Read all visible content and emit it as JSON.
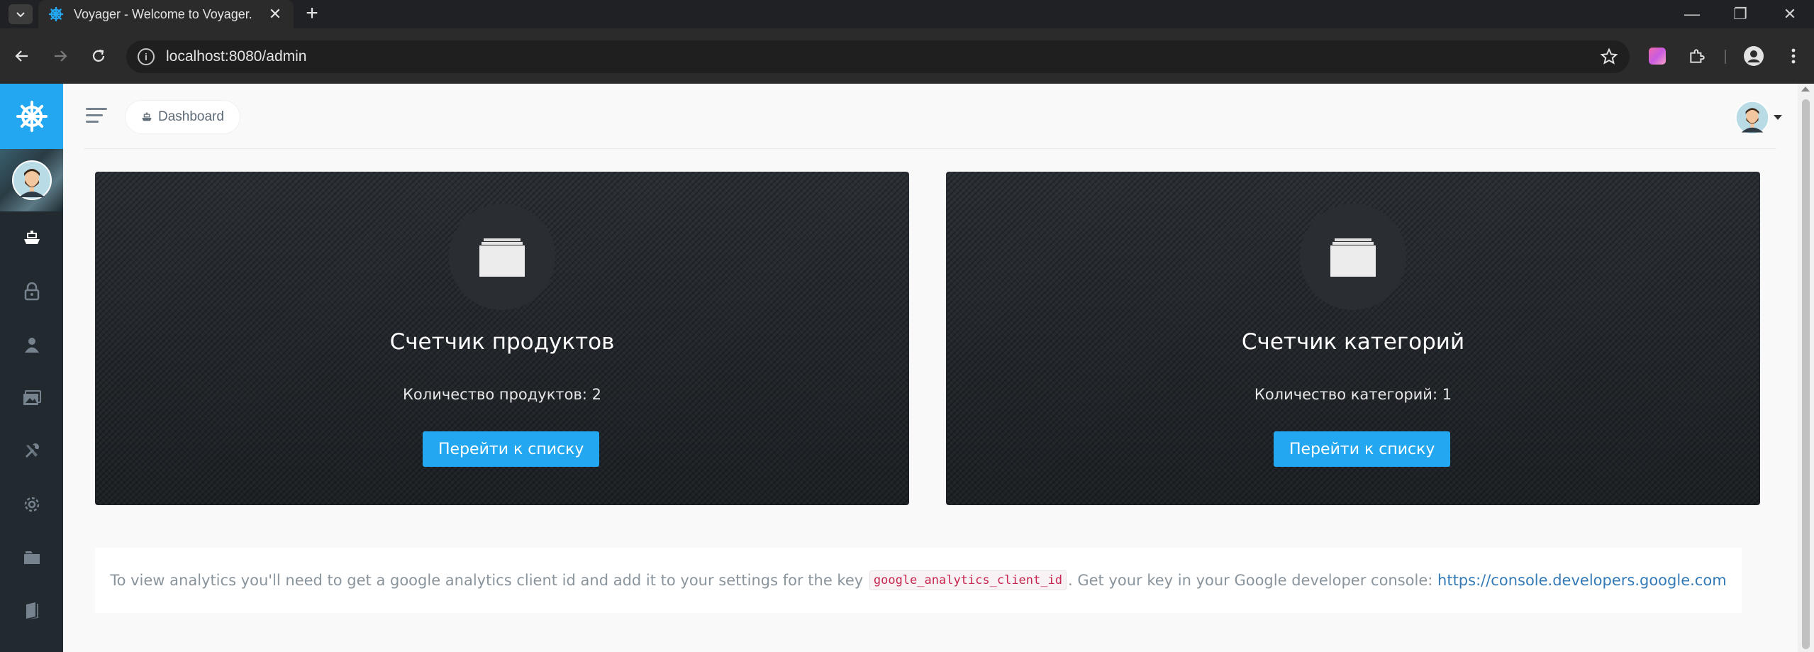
{
  "browser": {
    "tab_title": "Voyager - Welcome to Voyager.",
    "url": "localhost:8080/admin",
    "new_tab_label": "+",
    "minimize_glyph": "—",
    "restore_glyph": "❐",
    "close_glyph": "✕"
  },
  "sidebar": {
    "items": [
      {
        "name": "dashboard",
        "icon": "boat-icon",
        "active": true
      },
      {
        "name": "roles",
        "icon": "lock-icon"
      },
      {
        "name": "users",
        "icon": "person-icon"
      },
      {
        "name": "media",
        "icon": "images-icon"
      },
      {
        "name": "tools",
        "icon": "tools-icon"
      },
      {
        "name": "settings",
        "icon": "gear-icon"
      },
      {
        "name": "products",
        "icon": "folder-icon"
      },
      {
        "name": "categories",
        "icon": "book-icon"
      }
    ]
  },
  "header": {
    "breadcrumb": "Dashboard"
  },
  "cards": [
    {
      "title": "Счетчик продуктов",
      "text": "Количество продуктов: 2",
      "button": "Перейти к списку"
    },
    {
      "title": "Счетчик категорий",
      "text": "Количество категорий: 1",
      "button": "Перейти к списку"
    }
  ],
  "analytics": {
    "text_before": "To view analytics you'll need to get a google analytics client id and add it to your settings for the key ",
    "key": "google_analytics_client_id",
    "text_after": ". Get your key in your Google developer console: ",
    "link": "https://console.developers.google.com"
  },
  "colors": {
    "accent": "#22a7f0",
    "sidebar_bg": "#22292f",
    "code_color": "#c7254e",
    "link_color": "#337ab7"
  }
}
